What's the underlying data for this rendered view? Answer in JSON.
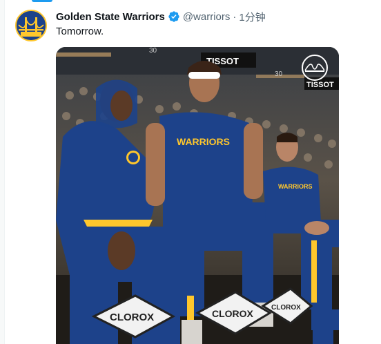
{
  "tweet": {
    "author": {
      "display_name": "Golden State Warriors",
      "handle": "@warriors",
      "verified": true,
      "avatar_icon": "warriors-bridge-logo-icon",
      "avatar_colors": {
        "bg": "#1d428a",
        "ring": "#ffc72c"
      }
    },
    "separator": "·",
    "timestamp": "1分钟",
    "text": "Tomorrow.",
    "media": {
      "kind": "photo",
      "jersey_text": "WARRIORS",
      "sponsor_text": "TISSOT",
      "floor_sign_text": "CLOROX",
      "arena_number": "30"
    }
  },
  "colors": {
    "accent": "#1d9bf0",
    "text_primary": "#0f1419",
    "text_secondary": "#536471",
    "warriors_blue": "#1d428a",
    "warriors_gold": "#ffc72c"
  }
}
